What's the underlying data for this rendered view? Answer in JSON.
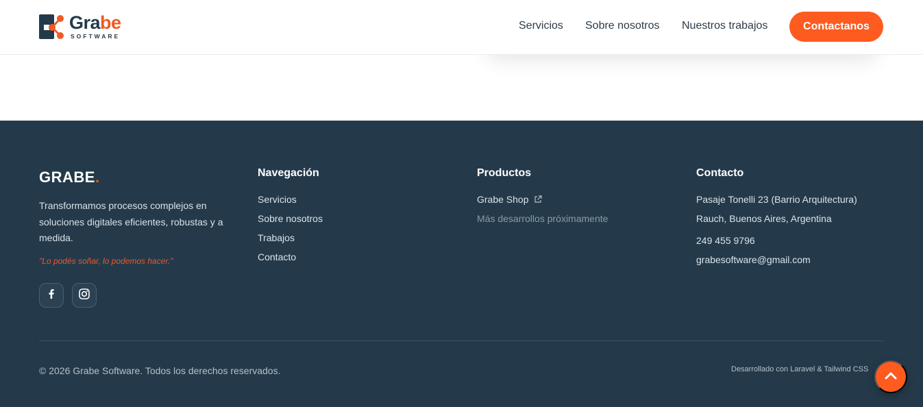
{
  "header": {
    "logo": {
      "word_part1": "Gra",
      "word_part2": "be",
      "subtitle": "SOFTWARE"
    },
    "nav": [
      {
        "label": "Servicios"
      },
      {
        "label": "Sobre nosotros"
      },
      {
        "label": "Nuestros trabajos"
      }
    ],
    "cta_label": "Contactanos"
  },
  "footer": {
    "brand": {
      "name": "GRABE",
      "dot": "."
    },
    "description": "Transformamos procesos complejos en soluciones digitales eficientes, robustas y a medida.",
    "quote": "\"Lo podés soñar, lo podemos hacer.\"",
    "social": [
      {
        "icon": "facebook-icon"
      },
      {
        "icon": "instagram-icon"
      }
    ],
    "navigation": {
      "title": "Navegación",
      "links": [
        "Servicios",
        "Sobre nosotros",
        "Trabajos",
        "Contacto"
      ]
    },
    "products": {
      "title": "Productos",
      "shop_label": "Grabe Shop",
      "coming_soon": "Más desarrollos próximamente"
    },
    "contact": {
      "title": "Contacto",
      "address_line1": "Pasaje Tonelli 23 (Barrio Arquitectura)",
      "address_line2": "Rauch, Buenos Aires, Argentina",
      "phone": "249 455 9796",
      "email": "grabesoftware@gmail.com"
    },
    "copyright": "© 2026 Grabe Software. Todos los derechos reservados.",
    "made_with": "Desarrollado con Laravel & Tailwind CSS"
  },
  "colors": {
    "accent": "#fd5b1f",
    "footer_bg": "#243a4a",
    "brand_dark": "#243a4b"
  }
}
